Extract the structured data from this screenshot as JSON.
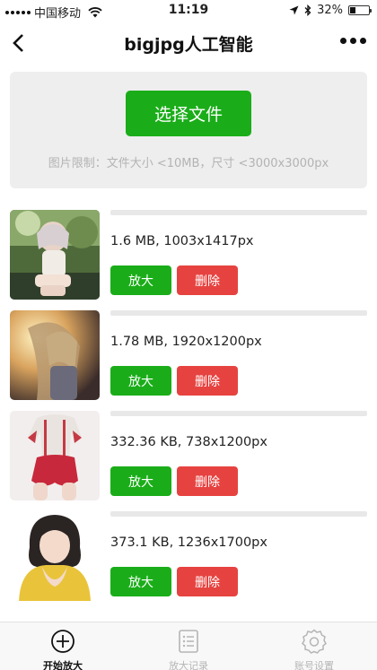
{
  "status_bar": {
    "carrier": "中国移动",
    "time": "11:19",
    "battery": "32%",
    "battery_level": 0.32
  },
  "nav": {
    "title": "bigjpg人工智能"
  },
  "upload": {
    "choose_label": "选择文件",
    "limit_text": "图片限制：文件大小 <10MB，尺寸 <3000x3000px"
  },
  "files": [
    {
      "info": "1.6 MB, 1003x1417px",
      "enlarge_label": "放大",
      "delete_label": "删除",
      "progress": 0
    },
    {
      "info": "1.78 MB, 1920x1200px",
      "enlarge_label": "放大",
      "delete_label": "删除",
      "progress": 0
    },
    {
      "info": "332.36 KB, 738x1200px",
      "enlarge_label": "放大",
      "delete_label": "删除",
      "progress": 0
    },
    {
      "info": "373.1 KB, 1236x1700px",
      "enlarge_label": "放大",
      "delete_label": "删除",
      "progress": 0
    }
  ],
  "tabs": [
    {
      "label": "开始放大",
      "icon": "plus-circle-icon",
      "active": true
    },
    {
      "label": "放大记录",
      "icon": "list-icon",
      "active": false
    },
    {
      "label": "账号设置",
      "icon": "gear-icon",
      "active": false
    }
  ],
  "colors": {
    "primary_green": "#1aad19",
    "danger_red": "#e64340",
    "panel_gray": "#eeeeee",
    "muted_text": "#b3b3b3"
  }
}
